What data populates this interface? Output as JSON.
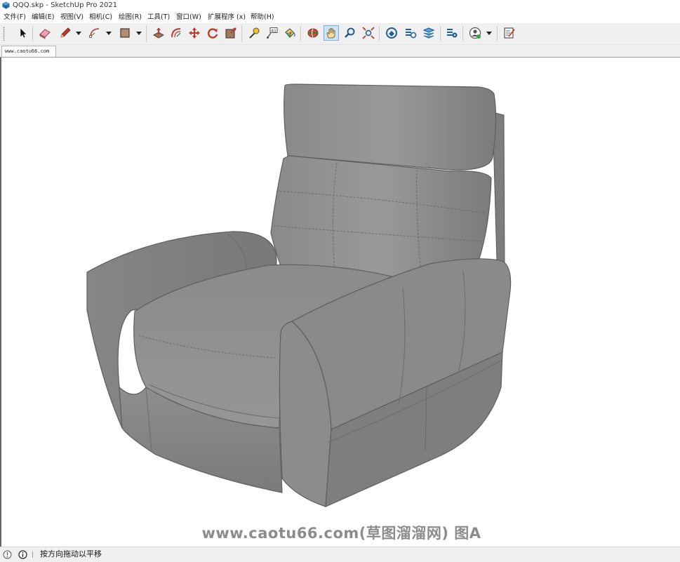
{
  "window": {
    "title": "QQQ.skp - SketchUp Pro 2021",
    "app_icon": "sketchup-logo-icon"
  },
  "menu": [
    {
      "label": "文件(F)"
    },
    {
      "label": "编辑(E)"
    },
    {
      "label": "视图(V)"
    },
    {
      "label": "相机(C)"
    },
    {
      "label": "绘图(R)"
    },
    {
      "label": "工具(T)"
    },
    {
      "label": "窗口(W)"
    },
    {
      "label": "扩展程序 (x)"
    },
    {
      "label": "帮助(H)"
    }
  ],
  "toolbar": {
    "tools": [
      {
        "name": "select",
        "icon": "arrow-cursor-icon"
      },
      {
        "name": "eraser",
        "icon": "eraser-icon"
      },
      {
        "name": "line",
        "icon": "pencil-icon",
        "dropdown": true
      },
      {
        "name": "arc",
        "icon": "arc-icon",
        "dropdown": true
      },
      {
        "name": "rectangle",
        "icon": "rectangle-icon",
        "dropdown": true
      },
      {
        "name": "push-pull",
        "icon": "push-pull-icon"
      },
      {
        "name": "offset",
        "icon": "offset-icon"
      },
      {
        "name": "move",
        "icon": "move-icon"
      },
      {
        "name": "rotate",
        "icon": "rotate-icon"
      },
      {
        "name": "scale",
        "icon": "scale-icon"
      },
      {
        "name": "tape-measure",
        "icon": "tape-measure-icon"
      },
      {
        "name": "text",
        "icon": "text-icon"
      },
      {
        "name": "paint-bucket",
        "icon": "paint-bucket-icon"
      },
      {
        "name": "orbit",
        "icon": "orbit-icon"
      },
      {
        "name": "pan",
        "icon": "pan-hand-icon",
        "active": true
      },
      {
        "name": "zoom",
        "icon": "zoom-icon"
      },
      {
        "name": "zoom-extents",
        "icon": "zoom-extents-icon"
      },
      {
        "name": "3d-warehouse",
        "icon": "warehouse-icon"
      },
      {
        "name": "extension-warehouse",
        "icon": "extension-warehouse-icon"
      },
      {
        "name": "layout",
        "icon": "layout-send-icon"
      },
      {
        "name": "extension-manager",
        "icon": "extension-manager-icon"
      },
      {
        "name": "account",
        "icon": "user-account-icon",
        "dropdown": true
      },
      {
        "name": "send-to-layout",
        "icon": "notes-icon"
      }
    ]
  },
  "tab": {
    "label": "www.caotu66.com"
  },
  "model": {
    "name": "armchair",
    "color": "#8f8f8f"
  },
  "watermark": {
    "text": "www.caotu66.com(草图溜溜网) 图A"
  },
  "status": {
    "icons": [
      "geolocation-icon",
      "info-icon"
    ],
    "text": "按方向拖动以平移"
  }
}
